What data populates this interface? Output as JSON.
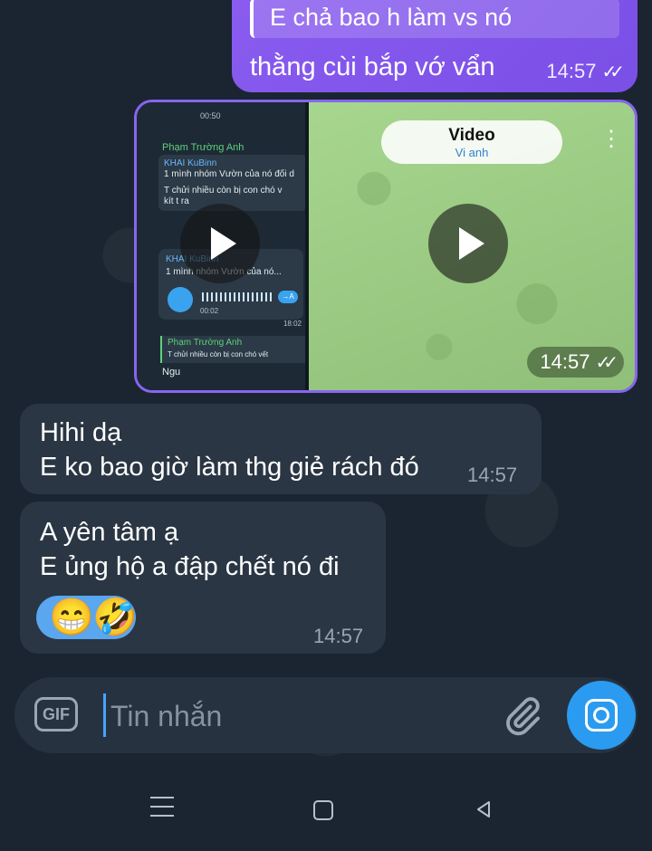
{
  "outgoing_message": {
    "quote_text": "E chả bao h làm vs nó",
    "text": "thằng cùi bắp vớ vẩn",
    "time": "14:57",
    "status": "read"
  },
  "media_album": {
    "time": "14:57",
    "left_media": {
      "time_top": "00:50",
      "sender_name": "Phạm Trường Anh",
      "quote_name": "KHAI KuBinn",
      "quote_line1": "1 mình nhóm Vườn của nó đối d",
      "quote_line2": "T chửi nhiều còn bị con chó v",
      "quote_line3": "kít t ra",
      "voice_sender": "KHAI KuBinn",
      "voice_quote": "1 mình nhóm Vườn của nó...",
      "voice_duration": "00:02",
      "voice_tag": "→A",
      "voice_time": "18:02",
      "reply_name": "Phạm Trường Anh",
      "reply_text": "T chửi nhiều còn bị con chó vết",
      "reply_msg": "Ngu"
    },
    "right_media": {
      "title": "Video",
      "subtitle": "Vi anh"
    }
  },
  "incoming_messages": [
    {
      "lines": [
        "Hihi dạ",
        "E ko bao giờ làm thg giẻ rách đó"
      ],
      "time": "14:57"
    },
    {
      "lines": [
        "A yên tâm ạ",
        "E ủng hộ a đập chết nó đi"
      ],
      "emojis": [
        "😁",
        "🤣"
      ],
      "time": "14:57"
    }
  ],
  "composer": {
    "gif_label": "GIF",
    "placeholder": "Tin nhắn"
  },
  "icons": {
    "attach": "paperclip-icon",
    "camera": "camera-icon",
    "nav": [
      "menu-icon",
      "home-icon",
      "back-icon"
    ]
  },
  "colors": {
    "background": "#1a2531",
    "outgoing_bubble": "#8a5cf0",
    "incoming_bubble": "#2a3644",
    "accent": "#2a9bf0"
  }
}
